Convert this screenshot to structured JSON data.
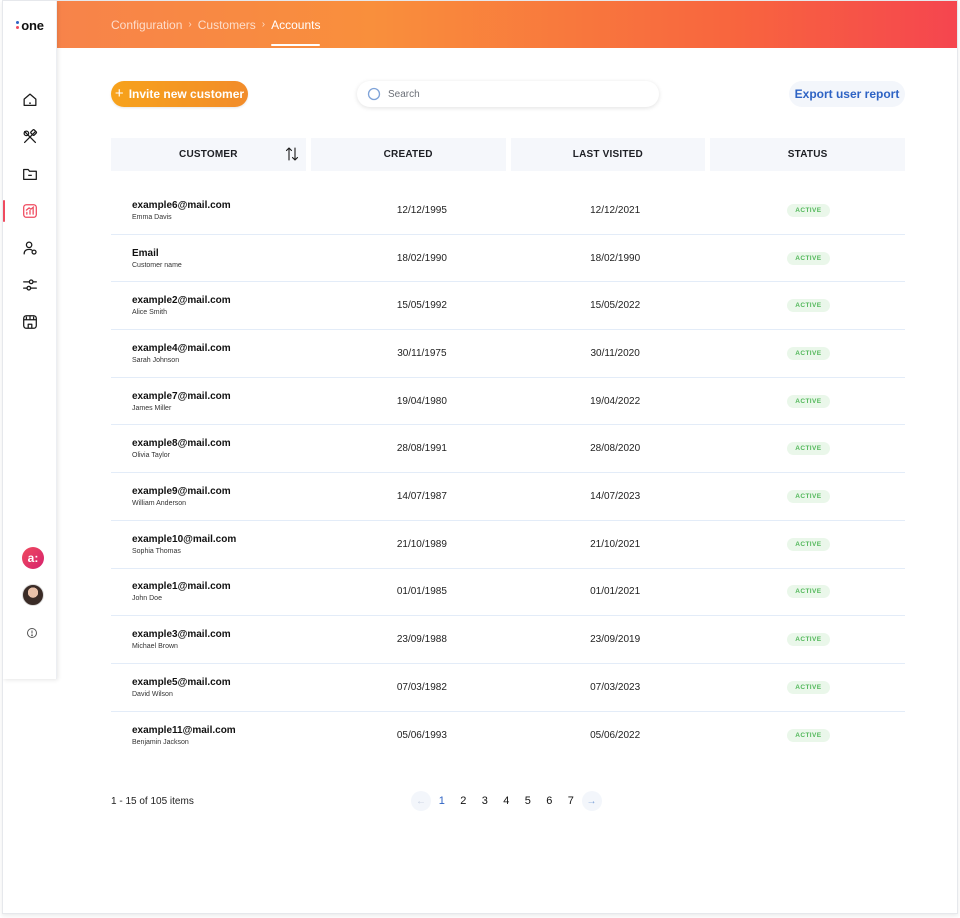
{
  "brand": {
    "logo_text": "one",
    "dot_colors": [
      "#2e63c4",
      "#ef4a5e"
    ]
  },
  "breadcrumb": {
    "items": [
      "Configuration",
      "Customers"
    ],
    "current": "Accounts"
  },
  "toolbar": {
    "invite_label": "Invite new customer",
    "search_placeholder": "Search",
    "export_label": "Export user report"
  },
  "sidebar": {
    "items": [
      {
        "icon": "home-icon",
        "active": false
      },
      {
        "icon": "tools-icon",
        "active": false
      },
      {
        "icon": "folder-icon",
        "active": false
      },
      {
        "icon": "analytics-icon",
        "active": true
      },
      {
        "icon": "users-icon",
        "active": false
      },
      {
        "icon": "sliders-icon",
        "active": false
      },
      {
        "icon": "store-icon",
        "active": false
      }
    ],
    "account_badge": "a:",
    "help_icon": "help-icon"
  },
  "table": {
    "headers": {
      "customer": "CUSTOMER",
      "created": "CREATED",
      "last_visited": "LAST VISITED",
      "status": "STATUS"
    },
    "rows": [
      {
        "email": "example6@mail.com",
        "name": "Emma Davis",
        "created": "12/12/1995",
        "last_visited": "12/12/2021",
        "status": "ACTIVE"
      },
      {
        "email": "Email",
        "name": "Customer name",
        "created": "18/02/1990",
        "last_visited": "18/02/1990",
        "status": "ACTIVE"
      },
      {
        "email": "example2@mail.com",
        "name": "Alice Smith",
        "created": "15/05/1992",
        "last_visited": "15/05/2022",
        "status": "ACTIVE"
      },
      {
        "email": "example4@mail.com",
        "name": "Sarah Johnson",
        "created": "30/11/1975",
        "last_visited": "30/11/2020",
        "status": "ACTIVE"
      },
      {
        "email": "example7@mail.com",
        "name": "James Miller",
        "created": "19/04/1980",
        "last_visited": "19/04/2022",
        "status": "ACTIVE"
      },
      {
        "email": "example8@mail.com",
        "name": "Olivia Taylor",
        "created": "28/08/1991",
        "last_visited": "28/08/2020",
        "status": "ACTIVE"
      },
      {
        "email": "example9@mail.com",
        "name": "William Anderson",
        "created": "14/07/1987",
        "last_visited": "14/07/2023",
        "status": "ACTIVE"
      },
      {
        "email": "example10@mail.com",
        "name": "Sophia Thomas",
        "created": "21/10/1989",
        "last_visited": "21/10/2021",
        "status": "ACTIVE"
      },
      {
        "email": "example1@mail.com",
        "name": "John Doe",
        "created": "01/01/1985",
        "last_visited": "01/01/2021",
        "status": "ACTIVE"
      },
      {
        "email": "example3@mail.com",
        "name": "Michael Brown",
        "created": "23/09/1988",
        "last_visited": "23/09/2019",
        "status": "ACTIVE"
      },
      {
        "email": "example5@mail.com",
        "name": "David Wilson",
        "created": "07/03/1982",
        "last_visited": "07/03/2023",
        "status": "ACTIVE"
      },
      {
        "email": "example11@mail.com",
        "name": "Benjamin Jackson",
        "created": "05/06/1993",
        "last_visited": "05/06/2022",
        "status": "ACTIVE"
      }
    ]
  },
  "pagination": {
    "range_text": "1 - 15 of 105 items",
    "pages": [
      "1",
      "2",
      "3",
      "4",
      "5",
      "6",
      "7"
    ],
    "current_page": "1",
    "prev_icon": "arrow-left-icon",
    "next_icon": "arrow-right-icon"
  },
  "colors": {
    "accent": "#2e63c4",
    "header_start": "#f7834a",
    "header_end": "#f5454f",
    "active_indicator": "#ef4a5e",
    "status_text": "#52b85a"
  }
}
